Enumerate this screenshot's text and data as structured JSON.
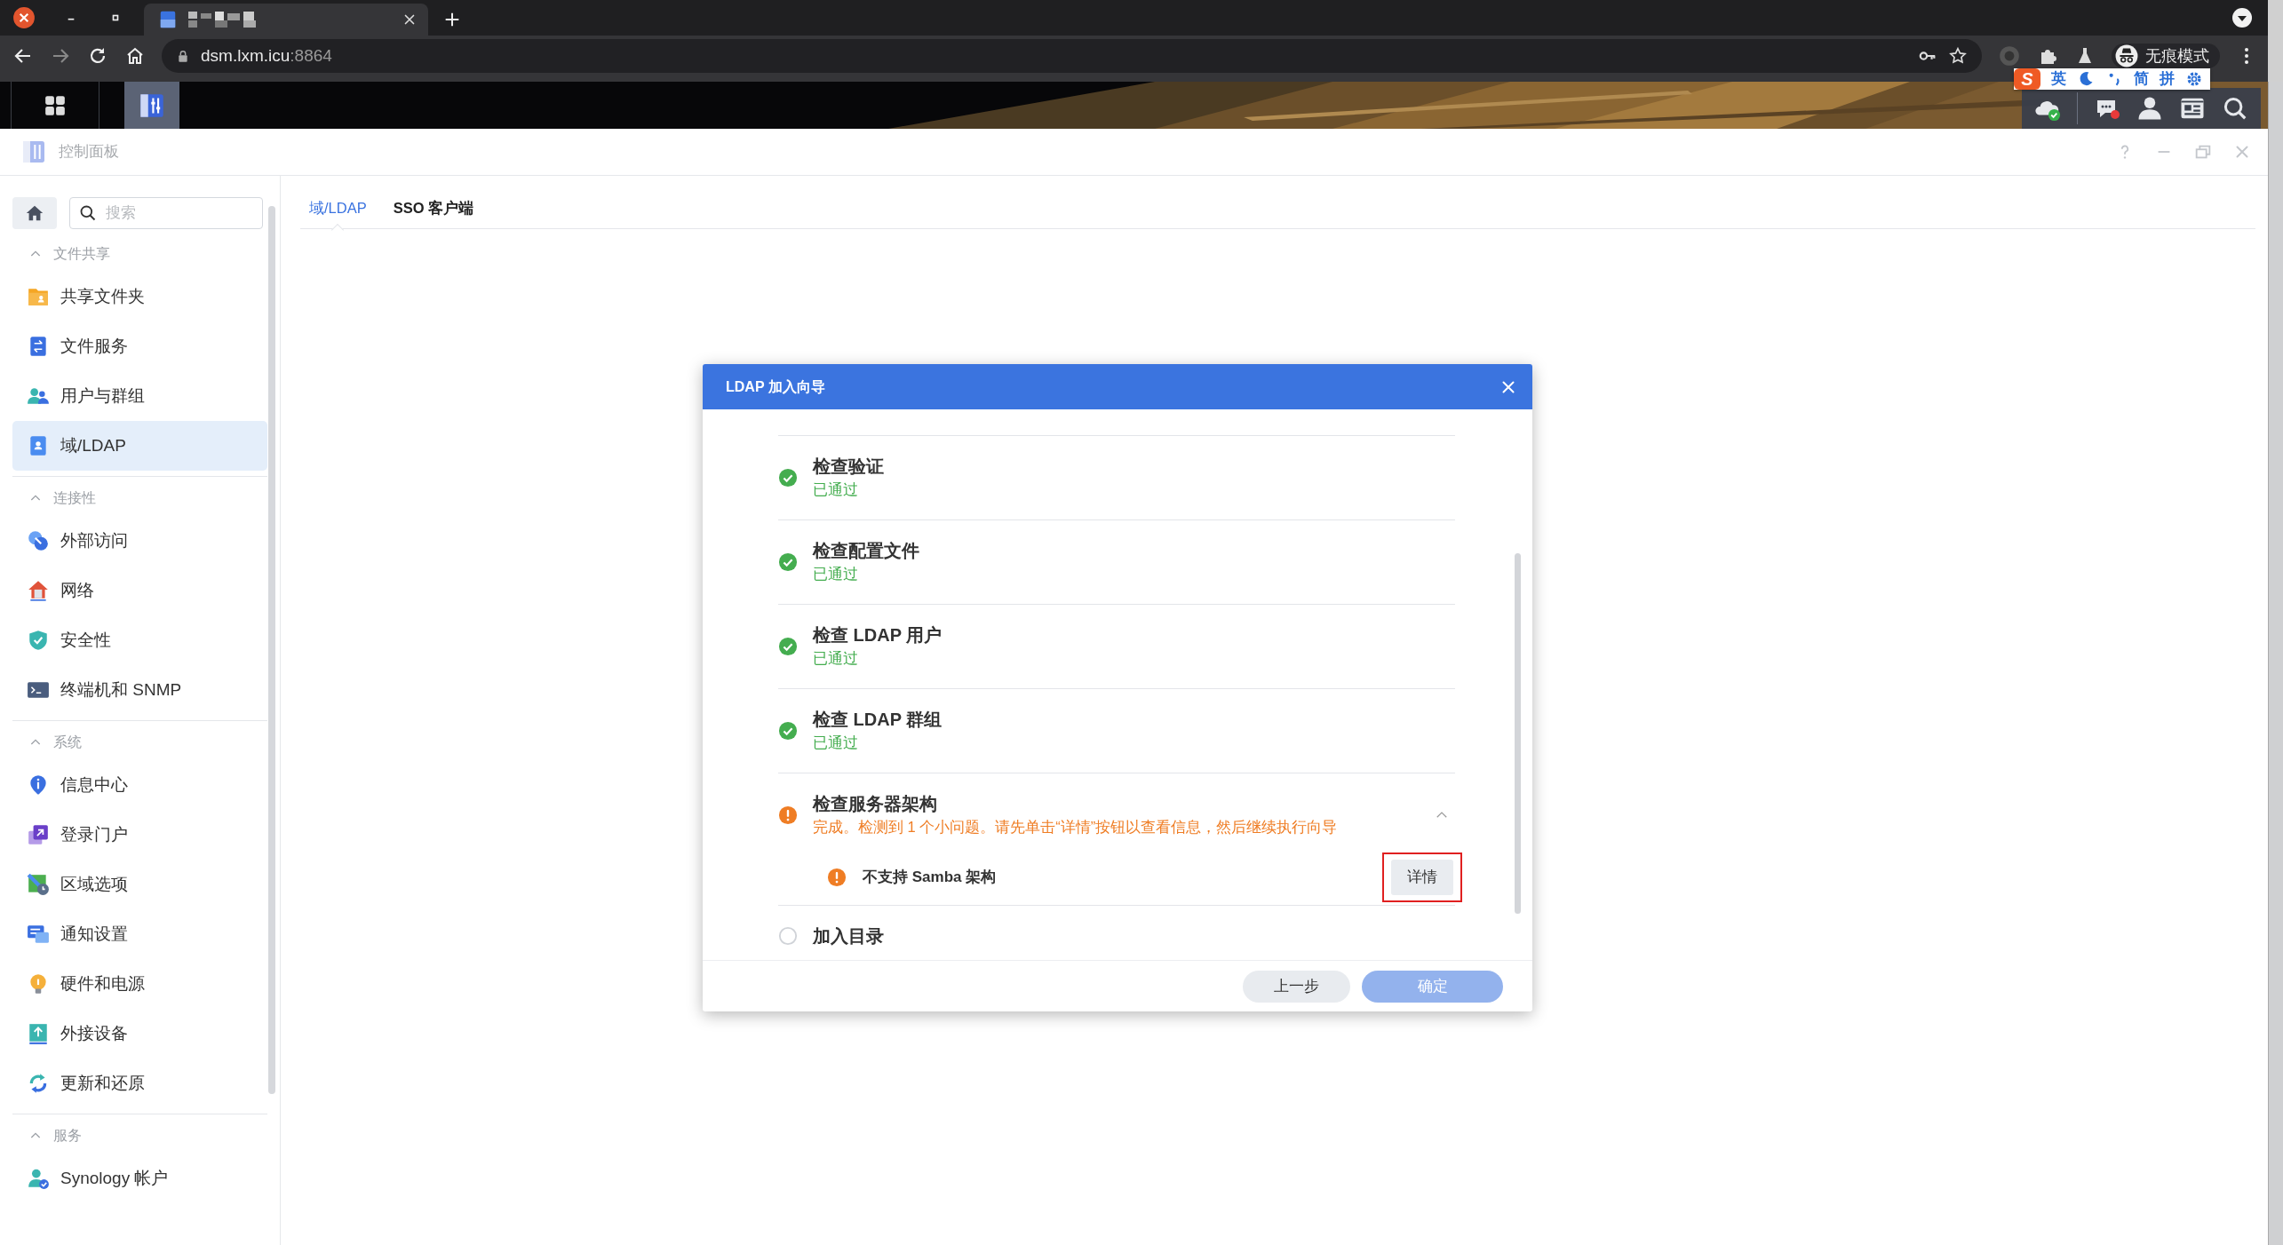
{
  "browser": {
    "address": {
      "host": "dsm.lxm.icu",
      "port": ":8864"
    },
    "profile": {
      "label": "无痕模式"
    },
    "ime_toolbar": {
      "logo": "S",
      "items": [
        "英",
        "简",
        "拼"
      ]
    }
  },
  "window": {
    "title": "控制面板"
  },
  "search": {
    "placeholder": "搜索"
  },
  "sidebar": {
    "sections": [
      {
        "title": "文件共享",
        "expanded": true,
        "items": [
          {
            "label": "共享文件夹",
            "selected": false
          },
          {
            "label": "文件服务",
            "selected": false
          },
          {
            "label": "用户与群组",
            "selected": false
          },
          {
            "label": "域/LDAP",
            "selected": true
          }
        ]
      },
      {
        "title": "连接性",
        "expanded": true,
        "items": [
          {
            "label": "外部访问",
            "selected": false
          },
          {
            "label": "网络",
            "selected": false
          },
          {
            "label": "安全性",
            "selected": false
          },
          {
            "label": "终端机和 SNMP",
            "selected": false
          }
        ]
      },
      {
        "title": "系统",
        "expanded": true,
        "items": [
          {
            "label": "信息中心",
            "selected": false
          },
          {
            "label": "登录门户",
            "selected": false
          },
          {
            "label": "区域选项",
            "selected": false
          },
          {
            "label": "通知设置",
            "selected": false
          },
          {
            "label": "硬件和电源",
            "selected": false
          },
          {
            "label": "外接设备",
            "selected": false
          },
          {
            "label": "更新和还原",
            "selected": false
          }
        ]
      },
      {
        "title": "服务",
        "expanded": true,
        "items": [
          {
            "label": "Synology 帐户",
            "selected": false
          }
        ]
      }
    ]
  },
  "tabs": [
    {
      "label": "域/LDAP",
      "selected": true
    },
    {
      "label": "SSO 客户端",
      "selected": false
    }
  ],
  "dialog": {
    "title": "LDAP 加入向导",
    "steps": [
      {
        "title": "检查验证",
        "kind": "passed",
        "note": "已通过"
      },
      {
        "title": "检查配置文件",
        "kind": "passed",
        "note": "已通过"
      },
      {
        "title": "检查 LDAP 用户",
        "kind": "passed",
        "note": "已通过"
      },
      {
        "title": "检查 LDAP 群组",
        "kind": "passed",
        "note": "已通过"
      },
      {
        "title": "检查服务器架构",
        "kind": "warning",
        "note": "完成。检测到 1 个小问题。请先单击“详情”按钮以查看信息，然后继续执行向导",
        "expanded": true,
        "issues": [
          {
            "text": "不支持 Samba 架构",
            "button": "详情",
            "highlighted": true
          }
        ]
      },
      {
        "title": "加入目录",
        "kind": "pending"
      }
    ],
    "buttons": [
      {
        "label": "上一步",
        "kind": "secondary",
        "disabled": false
      },
      {
        "label": "确定",
        "kind": "primary",
        "disabled": true
      }
    ]
  }
}
